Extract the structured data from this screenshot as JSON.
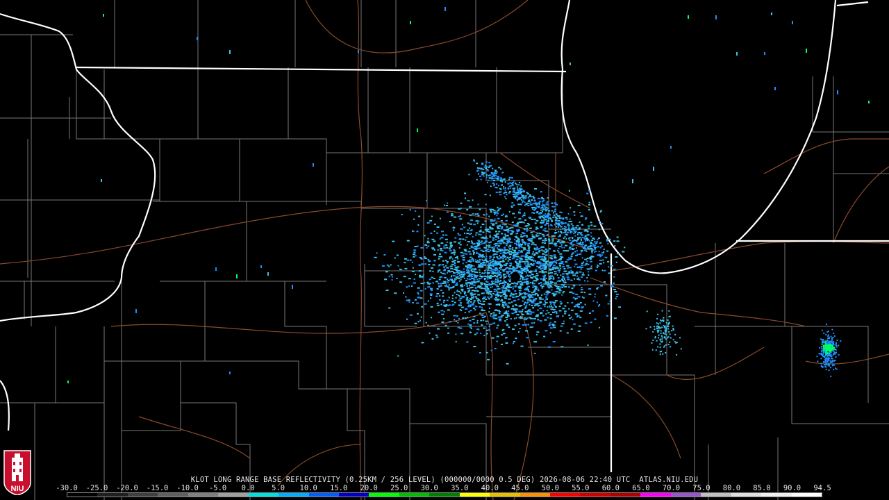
{
  "caption": "KLOT LONG RANGE BASE REFLECTIVITY (0.25KM / 256 LEVEL) (000000/0000 0.5 DEG) 2026-08-06 22:40 UTC  ATLAS.NIU.EDU",
  "logo": {
    "text": "NIU",
    "icon": "niu-tower-shield-icon",
    "color": "#c8102e"
  },
  "colorbar": {
    "labels": [
      "-30.0",
      "-25.0",
      "-20.0",
      "-15.0",
      "-10.0",
      "-5.0",
      "0.0",
      "5.0",
      "10.0",
      "15.0",
      "20.0",
      "25.0",
      "30.0",
      "35.0",
      "40.0",
      "45.0",
      "50.0",
      "55.0",
      "60.0",
      "65.0",
      "70.0",
      "75.0",
      "80.0",
      "85.0",
      "90.0",
      "94.5"
    ],
    "colors": [
      "#000000",
      "#202020",
      "#404040",
      "#606060",
      "#808080",
      "#a0a0a0",
      "#00e0e0",
      "#00b0ff",
      "#0060ff",
      "#0000c8",
      "#00ff00",
      "#00c000",
      "#008000",
      "#ffff00",
      "#e8c000",
      "#ff9000",
      "#ff0000",
      "#d00000",
      "#b00000",
      "#ff00ff",
      "#9955cc",
      "#c0c0c0",
      "#e0e0e0",
      "#f0f0f0",
      "#ffffff"
    ]
  },
  "map": {
    "background": "#000000",
    "state_color": "#ffffff",
    "county_color": "#7a7a7a",
    "road_color": "#8b4a2b",
    "echo_colors": [
      "#1e90ff",
      "#3fc1e6",
      "#00ff66"
    ]
  }
}
